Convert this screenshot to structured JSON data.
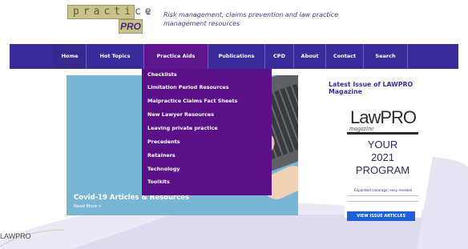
{
  "header": {
    "logo_top": "practice",
    "logo_pro": "PRO",
    "logo_reg": "®",
    "tagline": "Risk management, claims prevention and law practice management resources"
  },
  "nav": {
    "items": [
      "Home",
      "Hot Topics",
      "Practice Aids",
      "Publications",
      "CPD",
      "About",
      "Contact",
      "Search"
    ]
  },
  "dropdown": {
    "items": [
      "Checklists",
      "Limitation Period Resources",
      "Malpractice Claims Fact Sheets",
      "New Lawyer Resources",
      "Leaving private practice",
      "Precedents",
      "Retainers",
      "Technology",
      "Toolkits"
    ]
  },
  "feature": {
    "title": "Covid-19 Articles & Resources",
    "link": "Read More »"
  },
  "sidebar": {
    "title": "Latest Issue of LAWPRO Magazine",
    "mag_logo": "LawPRO",
    "mag_sub": "magazine",
    "mag_line1": "YOUR",
    "mag_line2": "2021",
    "mag_line3": "PROGRAM",
    "mag_small": "Expanded coverage; easy renewal",
    "button": "VIEW ISSUE ARTICLES"
  },
  "footer": {
    "logo": "LAWPRO"
  },
  "colors": {
    "nav_bg": "#3a2b9a",
    "active": "#5c158d",
    "dropdown": "#5a1188",
    "button": "#1f5fd8"
  }
}
